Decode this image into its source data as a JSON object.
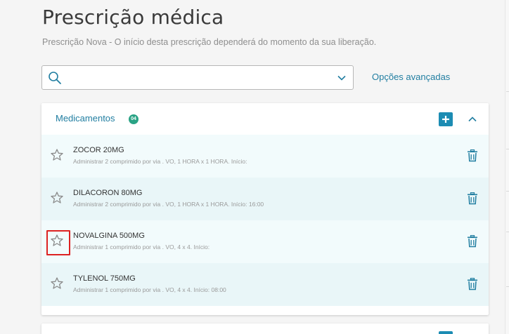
{
  "page": {
    "title": "Prescrição médica",
    "subtitle": "Prescrição Nova - O início desta prescrição dependerá do momento da sua liberação."
  },
  "search": {
    "value": "",
    "placeholder": "",
    "advanced_label": "Opções avançadas"
  },
  "panel": {
    "title": "Medicamentos",
    "count": "04"
  },
  "medications": [
    {
      "name": "ZOCOR 20MG",
      "desc": "Administrar 2 comprimido por via . VO, 1 HORA x 1 HORA. Início:"
    },
    {
      "name": "DILACORON 80MG",
      "desc": "Administrar 2 comprimido por via . VO, 1 HORA x 1 HORA. Início: 16:00"
    },
    {
      "name": "NOVALGINA 500MG",
      "desc": "Administrar 1 comprimido por via . VO, 4 x 4. Início:"
    },
    {
      "name": "TYLENOL 750MG",
      "desc": "Administrar 1 comprimido por via . VO, 4 x 4. Início: 08:00"
    }
  ],
  "colors": {
    "accent": "#217ea1",
    "button": "#1c8cb3",
    "badge": "#2aa385",
    "highlight": "#dd2222"
  },
  "icons": {
    "search": "search-icon",
    "dropdown": "chevron-down-icon",
    "add": "plus-icon",
    "collapse": "chevron-up-icon",
    "favorite": "star-icon",
    "delete": "trash-icon"
  }
}
